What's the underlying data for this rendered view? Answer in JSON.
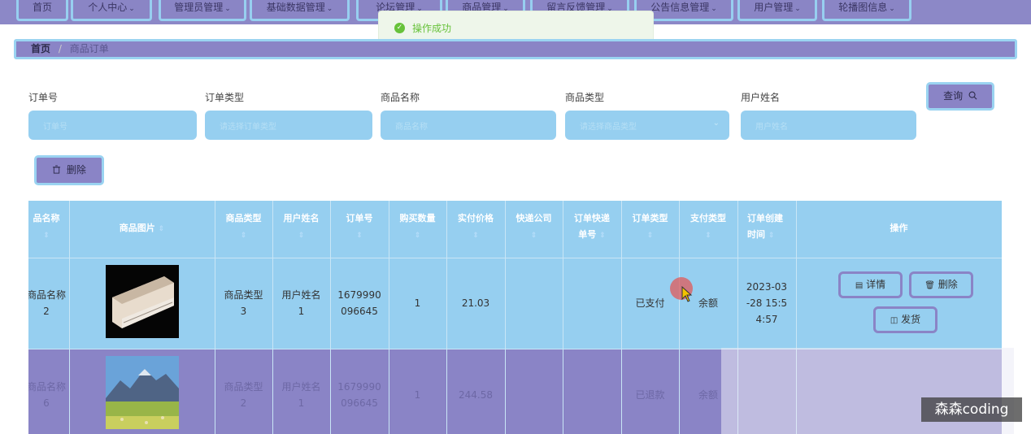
{
  "nav": {
    "items": [
      {
        "label": "首页",
        "chevron": ""
      },
      {
        "label": "个人中心",
        "chevron": "⌄"
      },
      {
        "label": "管理员管理",
        "chevron": "⌄"
      },
      {
        "label": "基础数据管理",
        "chevron": "⌄"
      },
      {
        "label": "论坛管理",
        "chevron": "⌄"
      },
      {
        "label": "商品管理",
        "chevron": "⌄"
      },
      {
        "label": "留言反馈管理",
        "chevron": "⌄"
      },
      {
        "label": "公告信息管理",
        "chevron": "⌄"
      },
      {
        "label": "用户管理",
        "chevron": "⌄"
      },
      {
        "label": "轮播图信息",
        "chevron": "⌄"
      }
    ]
  },
  "toast": {
    "message": "操作成功",
    "status_color": "#67c23a"
  },
  "breadcrumb": {
    "home": "首页",
    "separator": "/",
    "current": "商品订单"
  },
  "search": {
    "fields": [
      {
        "label": "订单号",
        "placeholder": "订单号"
      },
      {
        "label": "订单类型",
        "placeholder": "请选择订单类型"
      },
      {
        "label": "商品名称",
        "placeholder": "商品名称"
      },
      {
        "label": "商品类型",
        "placeholder": "请选择商品类型"
      },
      {
        "label": "用户姓名",
        "placeholder": "用户姓名"
      }
    ],
    "query_label": "查询"
  },
  "toolbar": {
    "delete_label": "删除"
  },
  "table": {
    "headers": {
      "name": "品名称",
      "image": "商品图片",
      "type": "商品类型",
      "user": "用户姓名",
      "order_no": "订单号",
      "qty": "购买数量",
      "price": "实付价格",
      "courier": "快递公司",
      "tracking1": "订单快递",
      "tracking2": "单号",
      "order_type": "订单类型",
      "pay_type": "支付类型",
      "created1": "订单创建",
      "created2": "时间",
      "ops": "操作"
    },
    "rows": [
      {
        "name1": "商品名称",
        "name2": "2",
        "type1": "商品类型",
        "type2": "3",
        "user1": "用户姓名",
        "user2": "1",
        "order1": "1679990",
        "order2": "096645",
        "qty": "1",
        "price": "21.03",
        "courier": "",
        "tracking": "",
        "order_type": "已支付",
        "pay_type": "余额",
        "created1": "2023-03",
        "created2": "-28 15:5",
        "created3": "4:57",
        "image_icon": "air-conditioner"
      },
      {
        "name1": "商品名称",
        "name2": "6",
        "type1": "商品类型",
        "type2": "2",
        "user1": "用户姓名",
        "user2": "1",
        "order1": "1679990",
        "order2": "096645",
        "qty": "1",
        "price": "244.58",
        "courier": "",
        "tracking": "",
        "order_type": "已退款",
        "pay_type": "余额",
        "image_icon": "mountain-landscape"
      }
    ],
    "actions": {
      "detail": "详情",
      "delete": "删除",
      "ship": "发货"
    }
  },
  "watermark": "森森coding",
  "colors": {
    "nav_bg": "#8c88c7",
    "accent_blue": "#96cff0",
    "accent_purple": "#8a84c6"
  }
}
